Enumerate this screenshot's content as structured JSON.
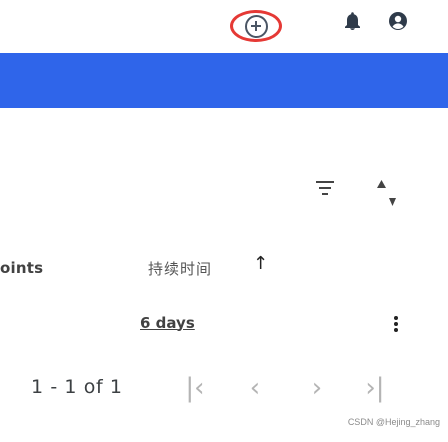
{
  "header": {
    "add_icon": "add-circle-outline",
    "notification_icon": "bell",
    "account_icon": "account-circle"
  },
  "controls": {
    "filter_icon": "filter-list",
    "sort_icon": "sort-arrows"
  },
  "table": {
    "first_column_label": "oints",
    "second_column_label": "持续时间",
    "sort_indicator": "↑",
    "row": {
      "duration": "6 days",
      "menu_icon": "more-vert"
    }
  },
  "pagination": {
    "range_text": "1 - 1 of 1",
    "first_icon": "first-page",
    "prev_icon": "chevron-left",
    "next_icon": "chevron-right",
    "last_icon": "last-page"
  },
  "watermark": {
    "text": "CSDN @Hejing_zhang"
  },
  "colors": {
    "accent_blue": "#2F65EA",
    "highlight_red": "#E53935",
    "text_dark": "#424242",
    "muted_gray": "#B4B4B4"
  }
}
